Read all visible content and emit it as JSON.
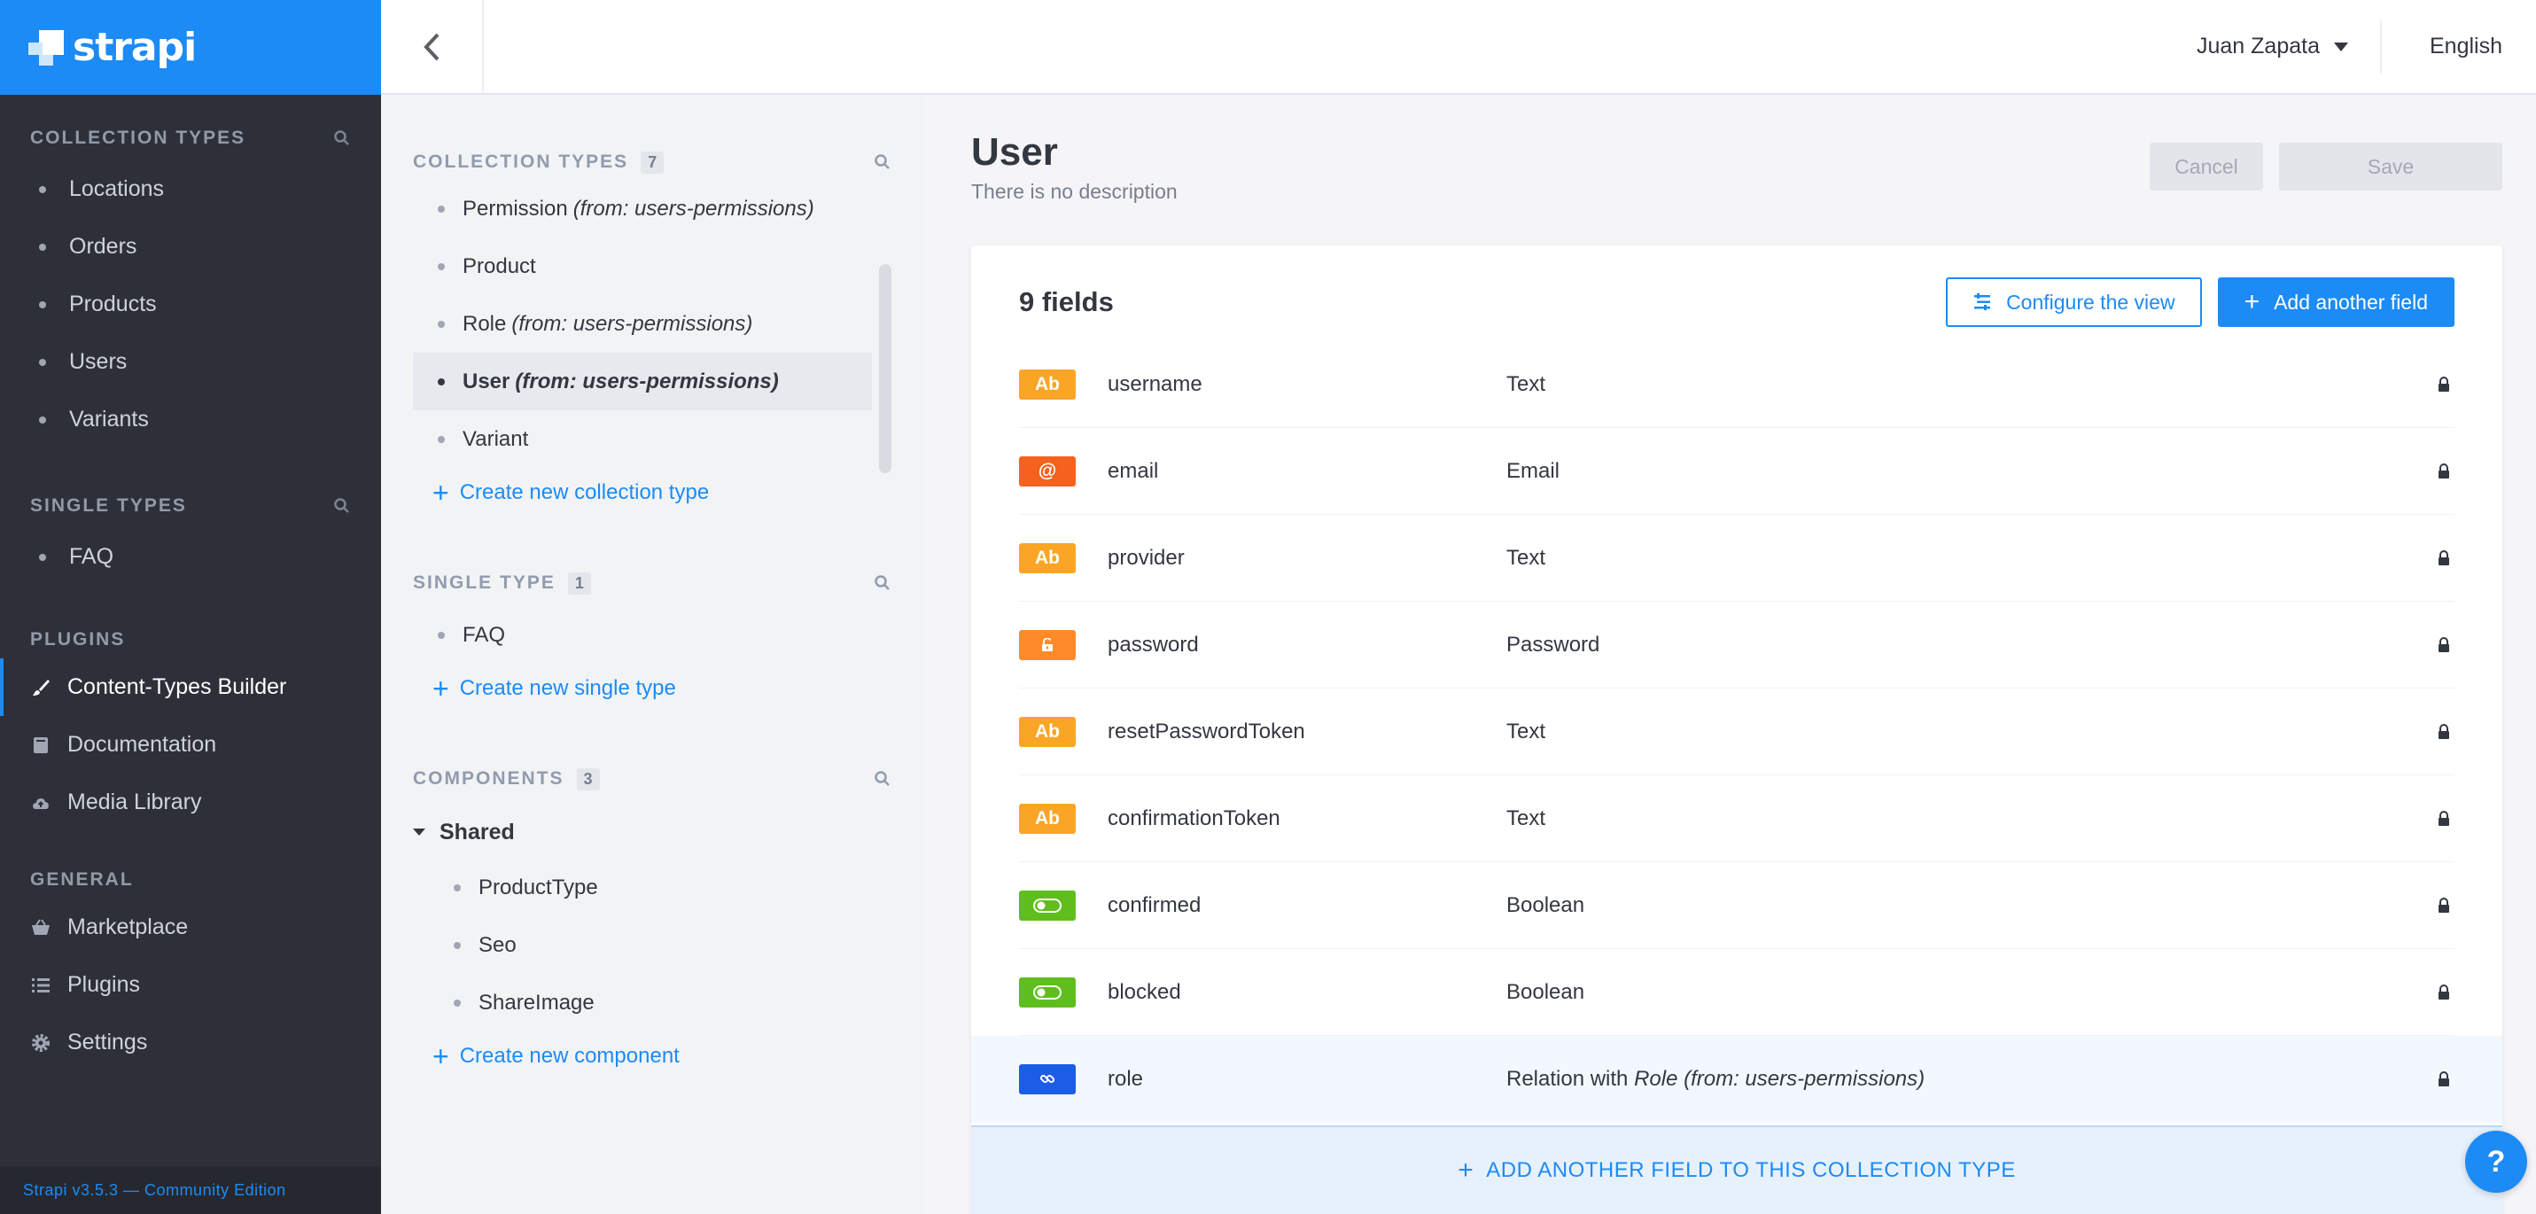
{
  "brand": {
    "name": "strapi"
  },
  "leftnav": {
    "collection_types": {
      "heading": "COLLECTION TYPES",
      "items": [
        {
          "label": "Locations"
        },
        {
          "label": "Orders"
        },
        {
          "label": "Products"
        },
        {
          "label": "Users"
        },
        {
          "label": "Variants"
        }
      ]
    },
    "single_types": {
      "heading": "SINGLE TYPES",
      "items": [
        {
          "label": "FAQ"
        }
      ]
    },
    "plugins": {
      "heading": "PLUGINS",
      "items": [
        {
          "label": "Content-Types Builder",
          "icon": "brush-icon",
          "active": true
        },
        {
          "label": "Documentation",
          "icon": "book-icon"
        },
        {
          "label": "Media Library",
          "icon": "cloud-upload-icon"
        }
      ]
    },
    "general": {
      "heading": "GENERAL",
      "items": [
        {
          "label": "Marketplace",
          "icon": "basket-icon"
        },
        {
          "label": "Plugins",
          "icon": "list-icon"
        },
        {
          "label": "Settings",
          "icon": "gear-icon"
        }
      ]
    },
    "footer": "Strapi v3.5.3 — Community Edition"
  },
  "topbar": {
    "user": "Juan Zapata",
    "language": "English"
  },
  "subnav": {
    "collection_types": {
      "heading": "COLLECTION TYPES",
      "count": "7",
      "items": [
        {
          "label": "Permission",
          "from": "(from: users-permissions)"
        },
        {
          "label": "Product",
          "from": ""
        },
        {
          "label": "Role",
          "from": "(from: users-permissions)"
        },
        {
          "label": "User",
          "from": "(from: users-permissions)",
          "active": true
        },
        {
          "label": "Variant",
          "from": ""
        }
      ],
      "create_label": "Create new collection type"
    },
    "single_type": {
      "heading": "SINGLE TYPE",
      "count": "1",
      "items": [
        {
          "label": "FAQ"
        }
      ],
      "create_label": "Create new single type"
    },
    "components": {
      "heading": "COMPONENTS",
      "count": "3",
      "group": "Shared",
      "items": [
        {
          "label": "ProductType"
        },
        {
          "label": "Seo"
        },
        {
          "label": "ShareImage"
        }
      ],
      "create_label": "Create new component"
    }
  },
  "main": {
    "title": "User",
    "description": "There is no description",
    "cancel_label": "Cancel",
    "save_label": "Save",
    "fields_count": "9 fields",
    "configure_label": "Configure the view",
    "add_field_label": "Add another field",
    "fields": [
      {
        "icon": "Ab",
        "color": "#faa526",
        "name": "username",
        "type": "Text",
        "type_em": ""
      },
      {
        "icon": "@",
        "color": "#f5621e",
        "name": "email",
        "type": "Email",
        "type_em": ""
      },
      {
        "icon": "Ab",
        "color": "#faa526",
        "name": "provider",
        "type": "Text",
        "type_em": ""
      },
      {
        "icon": "lock-open",
        "color": "#ff8a2a",
        "name": "password",
        "type": "Password",
        "type_em": ""
      },
      {
        "icon": "Ab",
        "color": "#faa526",
        "name": "resetPasswordToken",
        "type": "Text",
        "type_em": ""
      },
      {
        "icon": "Ab",
        "color": "#faa526",
        "name": "confirmationToken",
        "type": "Text",
        "type_em": ""
      },
      {
        "icon": "toggle",
        "color": "#5fbe1d",
        "name": "confirmed",
        "type": "Boolean",
        "type_em": ""
      },
      {
        "icon": "toggle",
        "color": "#5fbe1d",
        "name": "blocked",
        "type": "Boolean",
        "type_em": ""
      },
      {
        "icon": "link",
        "color": "#1c5de7",
        "name": "role",
        "type": "Relation with ",
        "type_em": "Role (from: users-permissions)"
      }
    ],
    "add_footer_label": "ADD ANOTHER FIELD TO THIS COLLECTION TYPE"
  },
  "help": {
    "label": "?"
  }
}
